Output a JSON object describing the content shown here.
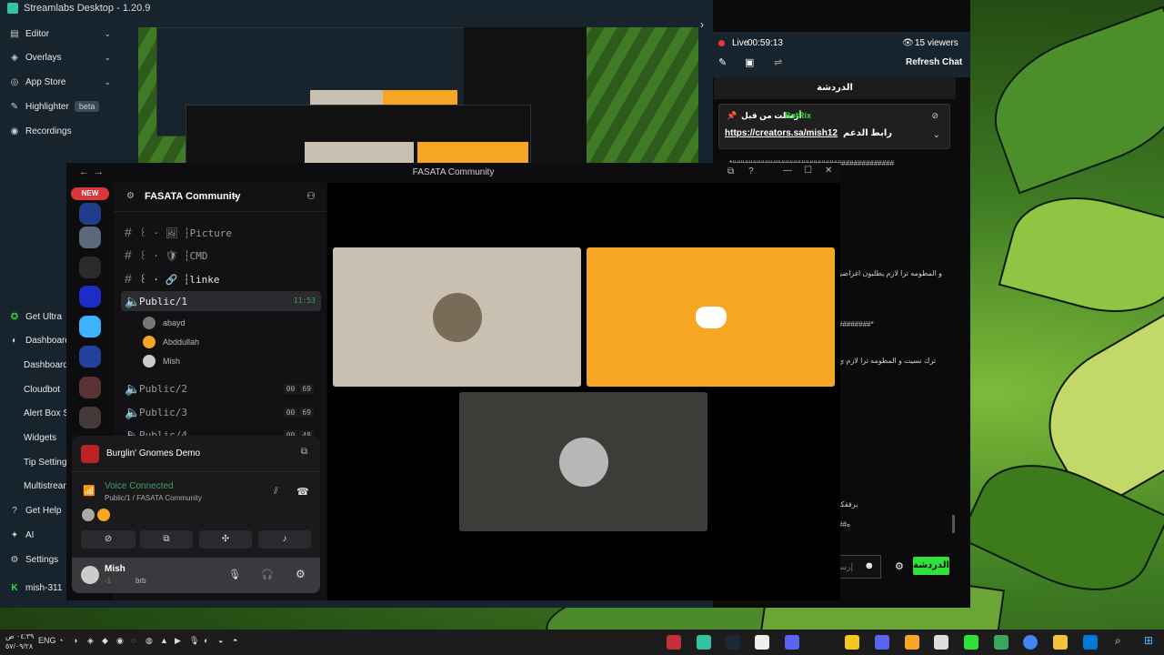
{
  "streamlabs": {
    "title": "Streamlabs Desktop - 1.20.9",
    "nav": {
      "editor": "Editor",
      "overlays": "Overlays",
      "app_store": "App Store",
      "highlighter": "Highlighter",
      "highlighter_badge": "beta",
      "recordings": "Recordings",
      "get_ultra": "Get Ultra",
      "dashboard": "Dashboard",
      "dashboard_sub": "Dashboard",
      "cloudbot": "Cloudbot",
      "alert_box": "Alert Box S",
      "widgets": "Widgets",
      "tip_settings": "Tip Settings",
      "multistream": "Multistrean",
      "get_help": "Get Help",
      "ai": "AI",
      "settings": "Settings",
      "account": "mish-311"
    }
  },
  "chat": {
    "live_label": "Live",
    "live_time": "00:59:13",
    "viewers": "15 viewers",
    "refresh": "Refresh Chat",
    "tab": "الدردشة",
    "pinned_by": "أرسلت من قبل",
    "pinned_user": "BotRix",
    "pinned_link": "https://creators.sa/mish12",
    "pinned_text": "رابط الدعم",
    "lines": [
      "*########################################",
      ".",
      "و المطومه ترا لازم يطلبون اغراضر",
      "########*",
      "ترك نسيت و المطومه ترا لازم ي",
      "برفقكا",
      "##ه"
    ],
    "input_placeholder": "إرسـ",
    "send": "الدردشة"
  },
  "discord": {
    "title": "FASATA Community",
    "new_badge": "NEW",
    "server_name": "FASATA Community",
    "channels": [
      {
        "name": "꒰ · 🖼 ┆Picture"
      },
      {
        "name": "꒰ · 🛡 ┆CMD"
      },
      {
        "name": "꒰ · 🔗 ┆linke"
      }
    ],
    "voice": [
      {
        "name": "Public/1",
        "timer": "11:53"
      },
      {
        "name": "Public/2",
        "count_a": "00",
        "count_b": "69"
      },
      {
        "name": "Public/3",
        "count_a": "00",
        "count_b": "69"
      },
      {
        "name": "Public/4",
        "count_a": "00",
        "count_b": "48"
      }
    ],
    "members": [
      "abayd",
      "Abddullah",
      "Mish"
    ],
    "activity": "Burglin' Gnomes Demo",
    "voice_status": "Voice Connected",
    "voice_location": "Public/1 / FASATA Community",
    "user_name": "Mish",
    "user_status": "brb",
    "user_status_prefix": "-1"
  },
  "taskbar": {
    "time": "٠٤:٣٩ ص",
    "date": "٥٧/٠٩/٢٨",
    "lang": "ENG"
  }
}
